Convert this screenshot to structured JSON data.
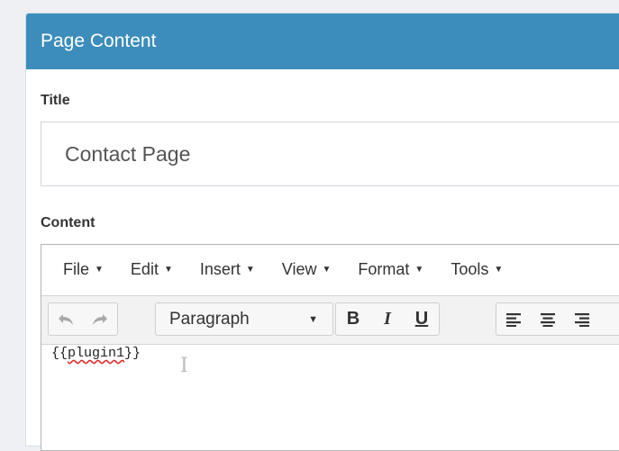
{
  "panel": {
    "title": "Page Content"
  },
  "title_field": {
    "label": "Title",
    "value": "Contact Page"
  },
  "content_field": {
    "label": "Content"
  },
  "editor": {
    "menu": [
      {
        "label": "File",
        "icon": "caret-down-icon"
      },
      {
        "label": "Edit",
        "icon": "caret-down-icon"
      },
      {
        "label": "Insert",
        "icon": "caret-down-icon"
      },
      {
        "label": "View",
        "icon": "caret-down-icon"
      },
      {
        "label": "Format",
        "icon": "caret-down-icon"
      },
      {
        "label": "Tools",
        "icon": "caret-down-icon"
      }
    ],
    "block_format": "Paragraph",
    "content": {
      "prefix": "{{",
      "token": "plugin1",
      "suffix": "}}"
    }
  },
  "colors": {
    "header": "#3c8dbc",
    "background": "#eef0f3",
    "spell_error": "#e02020"
  }
}
